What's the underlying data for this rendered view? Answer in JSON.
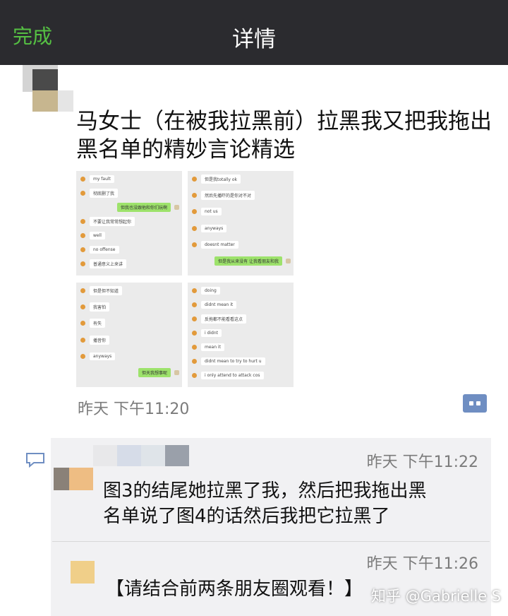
{
  "nav": {
    "done_label": "完成",
    "title": "详情"
  },
  "post": {
    "text": "马女士（在被我拉黑前）拉黑我又把我拖出黑名单的精妙言论精选",
    "time": "昨天 下午11:20",
    "screenshots": [
      {
        "messages": [
          {
            "side": "left",
            "text": "my fault"
          },
          {
            "side": "left",
            "text": "彻底删了我"
          },
          {
            "side": "right",
            "text": "但我也没跟他和你们玩啊"
          },
          {
            "side": "left",
            "text": "不要让我常常想起你"
          },
          {
            "side": "left",
            "text": "well"
          },
          {
            "side": "left",
            "text": "no offense"
          },
          {
            "side": "left",
            "text": "普通意义上来讲"
          }
        ]
      },
      {
        "messages": [
          {
            "side": "left",
            "text": "但是我totally ok"
          },
          {
            "side": "left",
            "text": "然后先播吓的是你对不对"
          },
          {
            "side": "left",
            "text": "not us"
          },
          {
            "side": "left",
            "text": "anyways"
          },
          {
            "side": "left",
            "text": "doesnt matter"
          },
          {
            "side": "right",
            "text": "但是我从来没有 让我看朋友和我"
          }
        ]
      },
      {
        "messages": [
          {
            "side": "left",
            "text": "但是但不知道"
          },
          {
            "side": "left",
            "text": "我害怕"
          },
          {
            "side": "left",
            "text": "有失"
          },
          {
            "side": "left",
            "text": "播音你"
          },
          {
            "side": "left",
            "text": "anyways"
          },
          {
            "side": "right",
            "text": "但天我想事呢"
          }
        ]
      },
      {
        "messages": [
          {
            "side": "left",
            "text": "doing"
          },
          {
            "side": "left",
            "text": "didnt mean it"
          },
          {
            "side": "left",
            "text": "反拖都不能看看这点"
          },
          {
            "side": "left",
            "text": "i didnt"
          },
          {
            "side": "left",
            "text": "mean it"
          },
          {
            "side": "left",
            "text": "didnt mean to try to hurt u"
          },
          {
            "side": "left",
            "text": "i only attend to attack cos"
          }
        ]
      }
    ]
  },
  "comments": [
    {
      "time": "昨天 下午11:22",
      "text_line1": "图3的结尾她拉黑了我，然后把我拖出黑",
      "text_line2": "名单说了图4的话然后我把它拉黑了"
    },
    {
      "time": "昨天 下午11:26",
      "text": "【请结合前两条朋友圈观看！】"
    }
  ],
  "watermark": "知乎 @Gabrielle S",
  "colors": {
    "nav_bg": "#2b2b2f",
    "done_green": "#55c043",
    "comment_bg": "#f1f1f3",
    "link_blue": "#6f8ec2"
  }
}
